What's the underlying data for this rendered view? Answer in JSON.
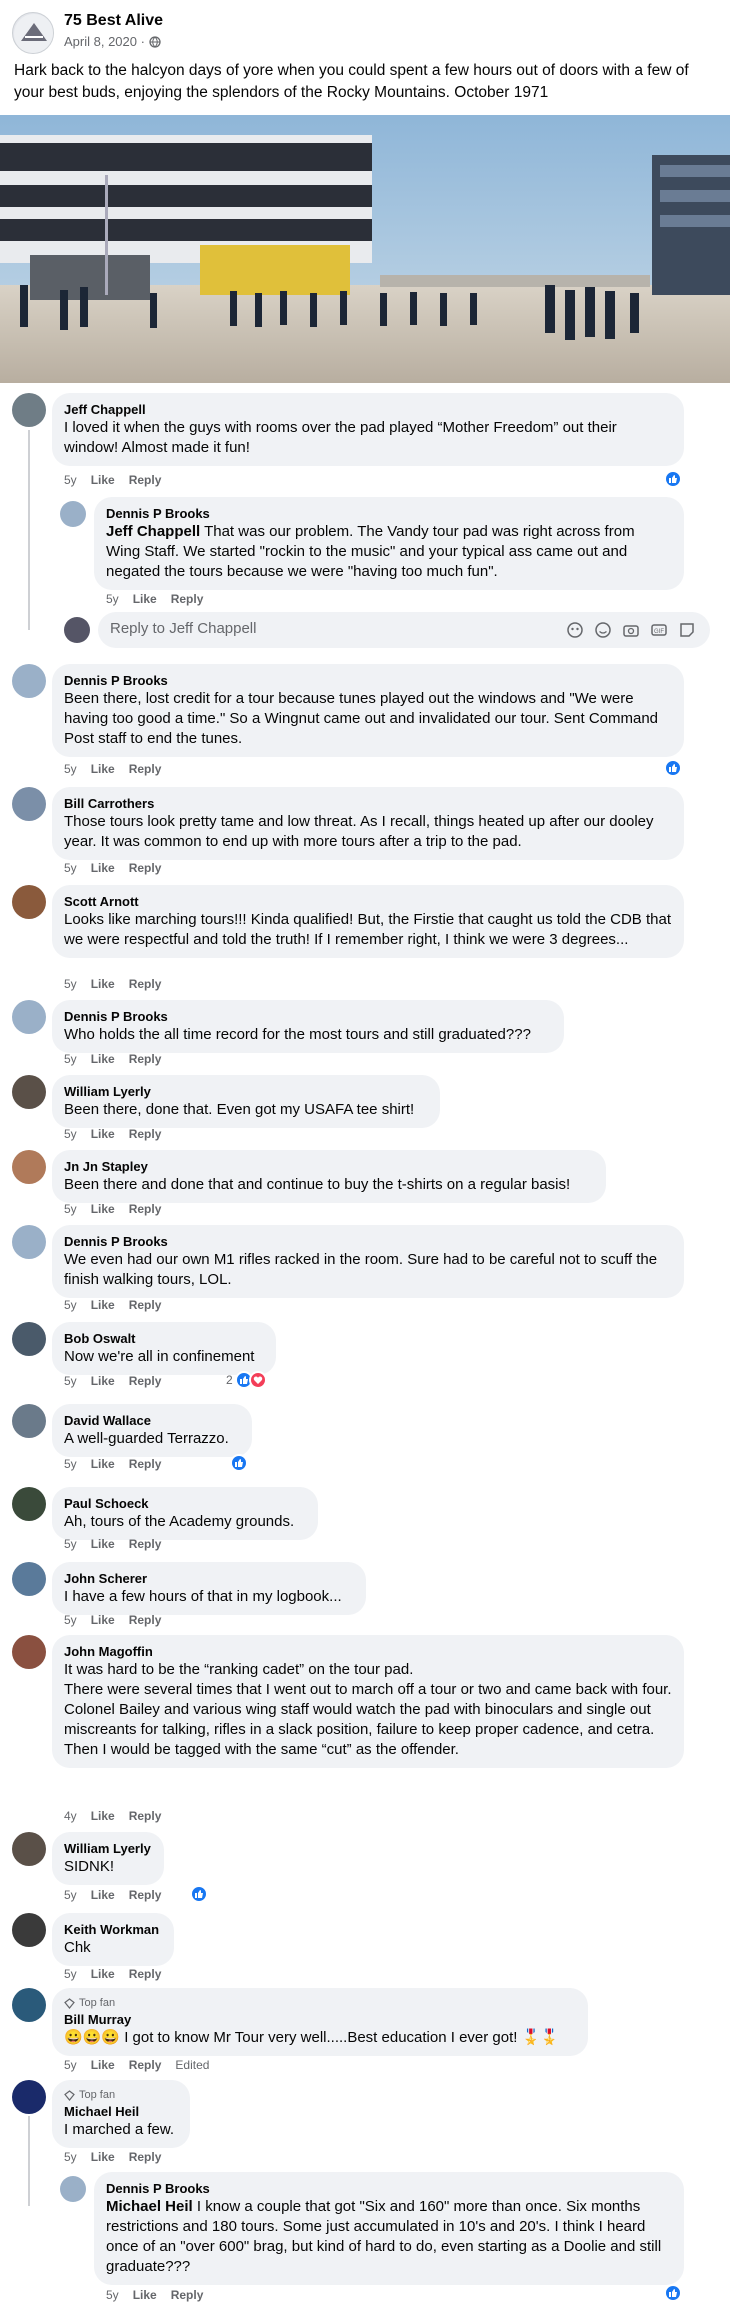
{
  "post": {
    "page_name": "75 Best Alive",
    "date": "April 8, 2020 ·",
    "text": "Hark back to the halcyon days of yore when you could spent a few hours out of doors with a few of your best buds, enjoying the splendors of the Rocky Mountains. October 1971"
  },
  "labels": {
    "like": "Like",
    "reply": "Reply",
    "edited": "Edited",
    "top_fan": "Top fan"
  },
  "reply_box": {
    "placeholder": "Reply to Jeff Chappell"
  },
  "comments": [
    {
      "author": "Jeff Chappell",
      "text": "I loved it when the guys with rooms over the pad played “Mother Freedom” out their window! Almost made it fun!",
      "time": "5y",
      "avatar_color": "#6f7d86"
    },
    {
      "author": "Dennis P Brooks",
      "mention": "Jeff Chappell",
      "text": " That was our problem. The Vandy tour pad was right across from Wing Staff. We started \"rockin to the music\" and your typical ass came out and negated the tours because we were \"having too much fun\".",
      "time": "5y",
      "avatar_color": "#9ab0c8"
    },
    {
      "author": "Dennis P Brooks",
      "text": "Been there, lost credit for a tour because tunes played out the windows and \"We were having too good a time.\" So a Wingnut came out and invalidated our tour. Sent Command Post staff to end the tunes.",
      "time": "5y",
      "avatar_color": "#9ab0c8"
    },
    {
      "author": "Bill Carrothers",
      "text": "Those tours look pretty tame and low threat. As I recall, things heated up after our dooley year. It was common to end up with more tours after a trip to the pad.",
      "time": "5y",
      "avatar_color": "#7b8fa8"
    },
    {
      "author": "Scott Arnott",
      "text": "Looks like marching tours!!! Kinda qualified! But, the Firstie that caught us told the CDB that we were respectful and told the truth! If I remember right, I think we were 3 degrees...",
      "time": "5y",
      "avatar_color": "#8a5a3c"
    },
    {
      "author": "Dennis P Brooks",
      "text": "Who holds the all time record for the most tours and still graduated???",
      "time": "5y",
      "avatar_color": "#9ab0c8"
    },
    {
      "author": "William Lyerly",
      "text": "Been there, done that. Even got my USAFA tee shirt!",
      "time": "5y",
      "avatar_color": "#5a5048"
    },
    {
      "author": "Jn Jn Stapley",
      "text": "Been there and done that and continue to buy the t-shirts on a regular basis!",
      "time": "5y",
      "avatar_color": "#b07a5a"
    },
    {
      "author": "Dennis P Brooks",
      "text": "We even had our own M1 rifles racked in the room. Sure had to be careful not to scuff the finish walking tours, LOL.",
      "time": "5y",
      "avatar_color": "#9ab0c8"
    },
    {
      "author": "Bob Oswalt",
      "text": "Now we're all in confinement",
      "time": "5y",
      "avatar_color": "#4a5a6a",
      "react_count": "2"
    },
    {
      "author": "David Wallace",
      "text": "A well-guarded Terrazzo.",
      "time": "5y",
      "avatar_color": "#6a7a8a"
    },
    {
      "author": "Paul Schoeck",
      "text": "Ah, tours of the Academy grounds.",
      "time": "5y",
      "avatar_color": "#3a4a3a"
    },
    {
      "author": "John Scherer",
      "text": "I have a few hours of that in my logbook...",
      "time": "5y",
      "avatar_color": "#5a7a9a"
    },
    {
      "author": "John Magoffin",
      "text_lines": [
        "It was hard to be the “ranking cadet” on the tour pad.",
        "There were several times that I went out to march off a tour or two and came back with four.",
        "Colonel Bailey and various wing staff would watch the pad with binoculars and single out miscreants for talking, rifles in a slack position, failure to keep proper cadence, and cetra.",
        "Then I would be tagged with the same “cut” as the offender."
      ],
      "time": "4y",
      "avatar_color": "#8a5040"
    },
    {
      "author": "William Lyerly",
      "text": "SIDNK!",
      "time": "5y",
      "avatar_color": "#5a5048"
    },
    {
      "author": "Keith Workman",
      "text": "Chk",
      "time": "5y",
      "avatar_color": "#3a3a3a"
    },
    {
      "author": "Bill Murray",
      "text": "😀😀😀 I got to know Mr Tour very well.....Best education I ever got! 🎖️🎖️",
      "time": "5y",
      "avatar_color": "#2a5a7a"
    },
    {
      "author": "Michael Heil",
      "text": "I marched a few.",
      "time": "5y",
      "avatar_color": "#1a2a6a"
    },
    {
      "author": "Dennis P Brooks",
      "mention": "Michael Heil",
      "text": " I know a couple that got \"Six and 160\" more than once. Six months restrictions and 180 tours. Some just accumulated in 10's and 20's. I think I heard once of an \"over 600\" brag, but kind of hard to do, even starting as a Doolie and still graduate???",
      "time": "5y",
      "avatar_color": "#9ab0c8"
    }
  ],
  "colors": {
    "like_blue": "#1877f2",
    "love_red": "#f33e58",
    "bubble": "#f0f2f5",
    "meta_gray": "#65676b"
  }
}
